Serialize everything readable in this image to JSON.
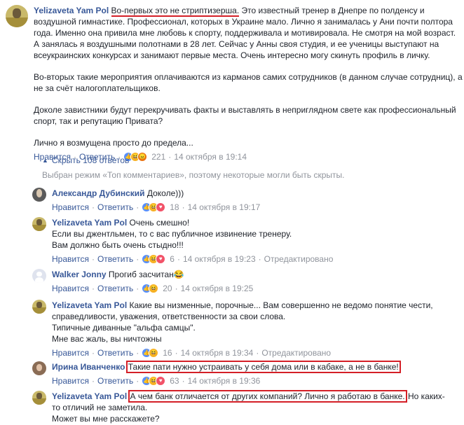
{
  "main_comment": {
    "author": "Yelizaveta Yam Pol",
    "paragraphs": [
      {
        "highlight": "Во-первых это не стриптизерша.",
        "lines": [
          " Это известный тренер в Днепре по полденсу и",
          "воздушной гимнастике. Профессионал, которых в Украине мало. Лично я занималась у Ани почти полтора",
          "года. Именно она привила мне любовь к спорту, поддерживала и мотивировала. Не смотря на мой возраст.",
          "А занялась я воздушными полотнами в 28 лет. Сейчас у Анны своя студия, и ее ученицы выступают на",
          "всеукраинских конкурсах и занимают первые места. Очень интересно могу скинуть профиль в личку."
        ]
      },
      {
        "lines": [
          "Во-вторых такие мероприятия оплачиваются из карманов самих сотрудников (в данном случае сотрудниц), а",
          "не за счёт налогоплательщиков."
        ]
      },
      {
        "lines": [
          "Доколе завистники будут перекручивать факты и выставлять в неприглядном свете как профессиональный",
          "спорт, так и репутацию Привата?"
        ]
      },
      {
        "lines": [
          "Лично я возмущена просто до предела..."
        ]
      }
    ],
    "like_label": "Нравится",
    "reply_label": "Ответить",
    "reactions": [
      "like",
      "haha",
      "angry"
    ],
    "reaction_count": "221",
    "time": "14 октября в 19:14"
  },
  "thread": {
    "hide_replies_label": "Скрыть 108 ответов",
    "filter_note": "Выбран режим «Топ комментариев», поэтому некоторые могли быть скрыты."
  },
  "replies": [
    {
      "author": "Александр Дубинский",
      "lines": [
        "Доколе)))"
      ],
      "like_label": "Нравится",
      "reply_label": "Ответить",
      "reactions": [
        "like",
        "haha",
        "love"
      ],
      "reaction_count": "18",
      "time": "14 октября в 19:17"
    },
    {
      "author": "Yelizaveta Yam Pol",
      "lines": [
        "Очень смешно!",
        "Если вы джентльмен, то с вас публичное извинение тренеру.",
        "Вам должно быть очень стыдно!!!"
      ],
      "like_label": "Нравится",
      "reply_label": "Ответить",
      "reactions": [
        "like",
        "haha",
        "love"
      ],
      "reaction_count": "6",
      "time": "14 октября в 19:23",
      "edited": "Отредактировано"
    },
    {
      "author": "Walker Jonny",
      "lines": [
        "Прогиб засчитан😂"
      ],
      "like_label": "Нравится",
      "reply_label": "Ответить",
      "reactions": [
        "like",
        "haha"
      ],
      "reaction_count": "20",
      "time": "14 октября в 19:25"
    },
    {
      "author": "Yelizaveta Yam Pol",
      "lines": [
        "Какие вы низменные, порочные... Вам совершенно не ведомо понятие чести,",
        "справедливости, уважения, ответственности за свои слова.",
        "Типичные диванные \"альфа самцы\".",
        "Мне вас жаль, вы ничтожны"
      ],
      "like_label": "Нравится",
      "reply_label": "Ответить",
      "reactions": [
        "like",
        "haha"
      ],
      "reaction_count": "16",
      "time": "14 октября в 19:34",
      "edited": "Отредактировано"
    },
    {
      "author": "Ирина Иванченко",
      "highlight": "Такие пати нужно устраивать у себя дома или в кабаке, а не в банке!",
      "lines": [],
      "like_label": "Нравится",
      "reply_label": "Ответить",
      "reactions": [
        "like",
        "haha",
        "love"
      ],
      "reaction_count": "63",
      "time": "14 октября в 19:36"
    },
    {
      "author": "Yelizaveta Yam Pol",
      "highlight": "А чем банк отличается от других компаний? Лично я работаю в банке.",
      "lines": [
        " Но каких-",
        "то отличий не заметила.",
        "Может вы мне расскажете?"
      ]
    }
  ]
}
